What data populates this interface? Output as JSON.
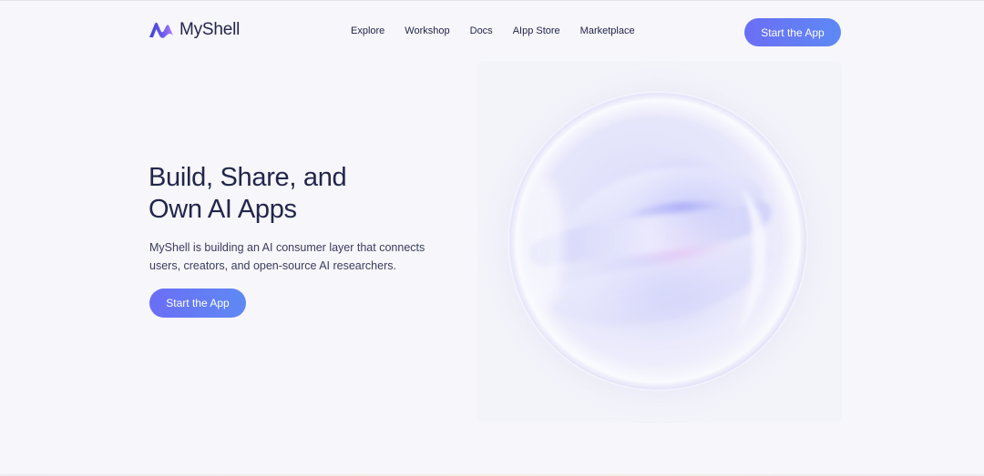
{
  "brand": {
    "name": "MyShell",
    "logo_icon": "myshell-wave-logo-icon"
  },
  "nav": {
    "items": [
      {
        "label": "Explore"
      },
      {
        "label": "Workshop"
      },
      {
        "label": "Docs"
      },
      {
        "label": "AIpp Store"
      },
      {
        "label": "Marketplace"
      }
    ]
  },
  "header": {
    "cta_label": "Start the App"
  },
  "hero": {
    "title_line1": "Build, Share, and",
    "title_line2": "Own AI Apps",
    "subtitle_line1": "MyShell is building an AI consumer layer that connects",
    "subtitle_line2": "users, creators, and open-source AI researchers.",
    "cta_label": "Start the App"
  },
  "colors": {
    "background": "#f6f6fb",
    "text": "#23264a",
    "accent_start": "#6b6ef5",
    "accent_end": "#5e89f4"
  }
}
